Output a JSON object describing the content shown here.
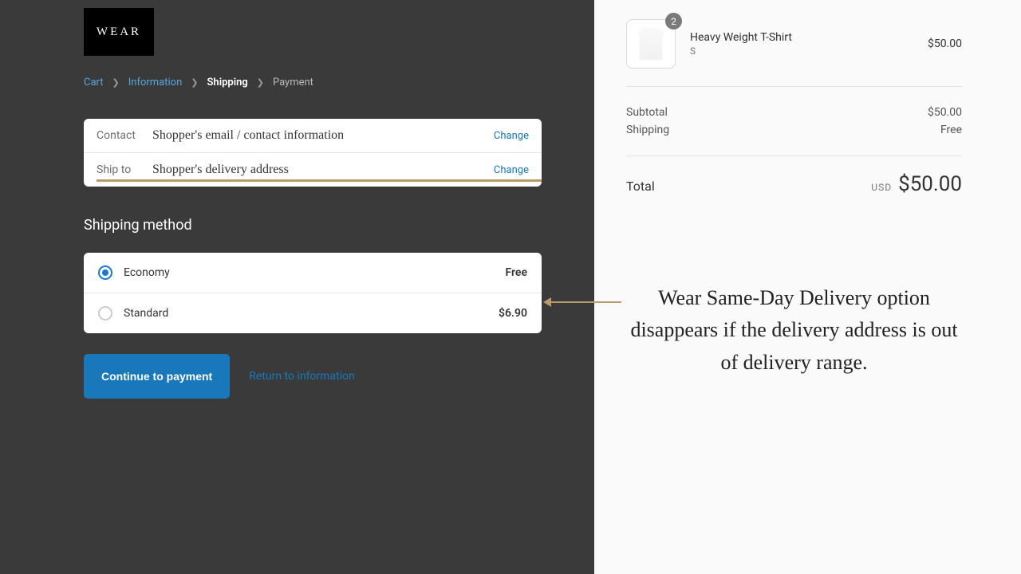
{
  "logo": {
    "text": "WEAR"
  },
  "breadcrumb": {
    "cart": "Cart",
    "information": "Information",
    "shipping": "Shipping",
    "payment": "Payment"
  },
  "review": {
    "contact_label": "Contact",
    "contact_value": "Shopper's email / contact information",
    "shipto_label": "Ship to",
    "shipto_value": "Shopper's delivery address",
    "change": "Change"
  },
  "shipping": {
    "title": "Shipping method",
    "options": [
      {
        "name": "Economy",
        "price": "Free",
        "selected": true
      },
      {
        "name": "Standard",
        "price": "$6.90",
        "selected": false
      }
    ]
  },
  "actions": {
    "continue": "Continue to payment",
    "return": "Return to information"
  },
  "order": {
    "item": {
      "qty": "2",
      "title": "Heavy Weight T-Shirt",
      "variant": "S",
      "price": "$50.00"
    },
    "subtotal_label": "Subtotal",
    "subtotal_value": "$50.00",
    "shipping_label": "Shipping",
    "shipping_value": "Free",
    "total_label": "Total",
    "currency": "USD",
    "total_value": "$50.00"
  },
  "annotation": "Wear Same-Day Delivery option disappears if the delivery address is out of delivery range."
}
